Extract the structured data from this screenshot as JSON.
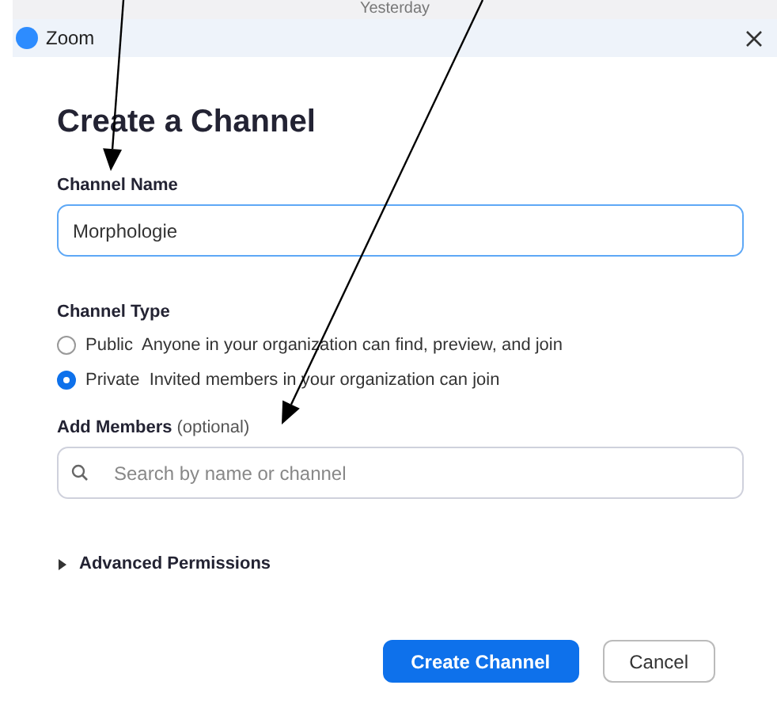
{
  "background_label": "Yesterday",
  "window": {
    "title": "Zoom"
  },
  "heading": "Create a Channel",
  "channel_name": {
    "label": "Channel Name",
    "value": "Morphologie"
  },
  "channel_type": {
    "label": "Channel Type",
    "options": [
      {
        "name": "Public",
        "description": "Anyone in your organization can find, preview, and join",
        "selected": false
      },
      {
        "name": "Private",
        "description": "Invited members in your organization can join",
        "selected": true
      }
    ]
  },
  "add_members": {
    "label": "Add Members",
    "hint": "(optional)",
    "placeholder": "Search by name or channel"
  },
  "advanced_permissions": {
    "label": "Advanced Permissions",
    "expanded": false
  },
  "buttons": [
    {
      "label": "Create Channel",
      "kind": "primary"
    },
    {
      "label": "Cancel",
      "kind": "secondary"
    }
  ],
  "annotations": [
    {
      "kind": "arrow"
    },
    {
      "kind": "arrow"
    }
  ]
}
